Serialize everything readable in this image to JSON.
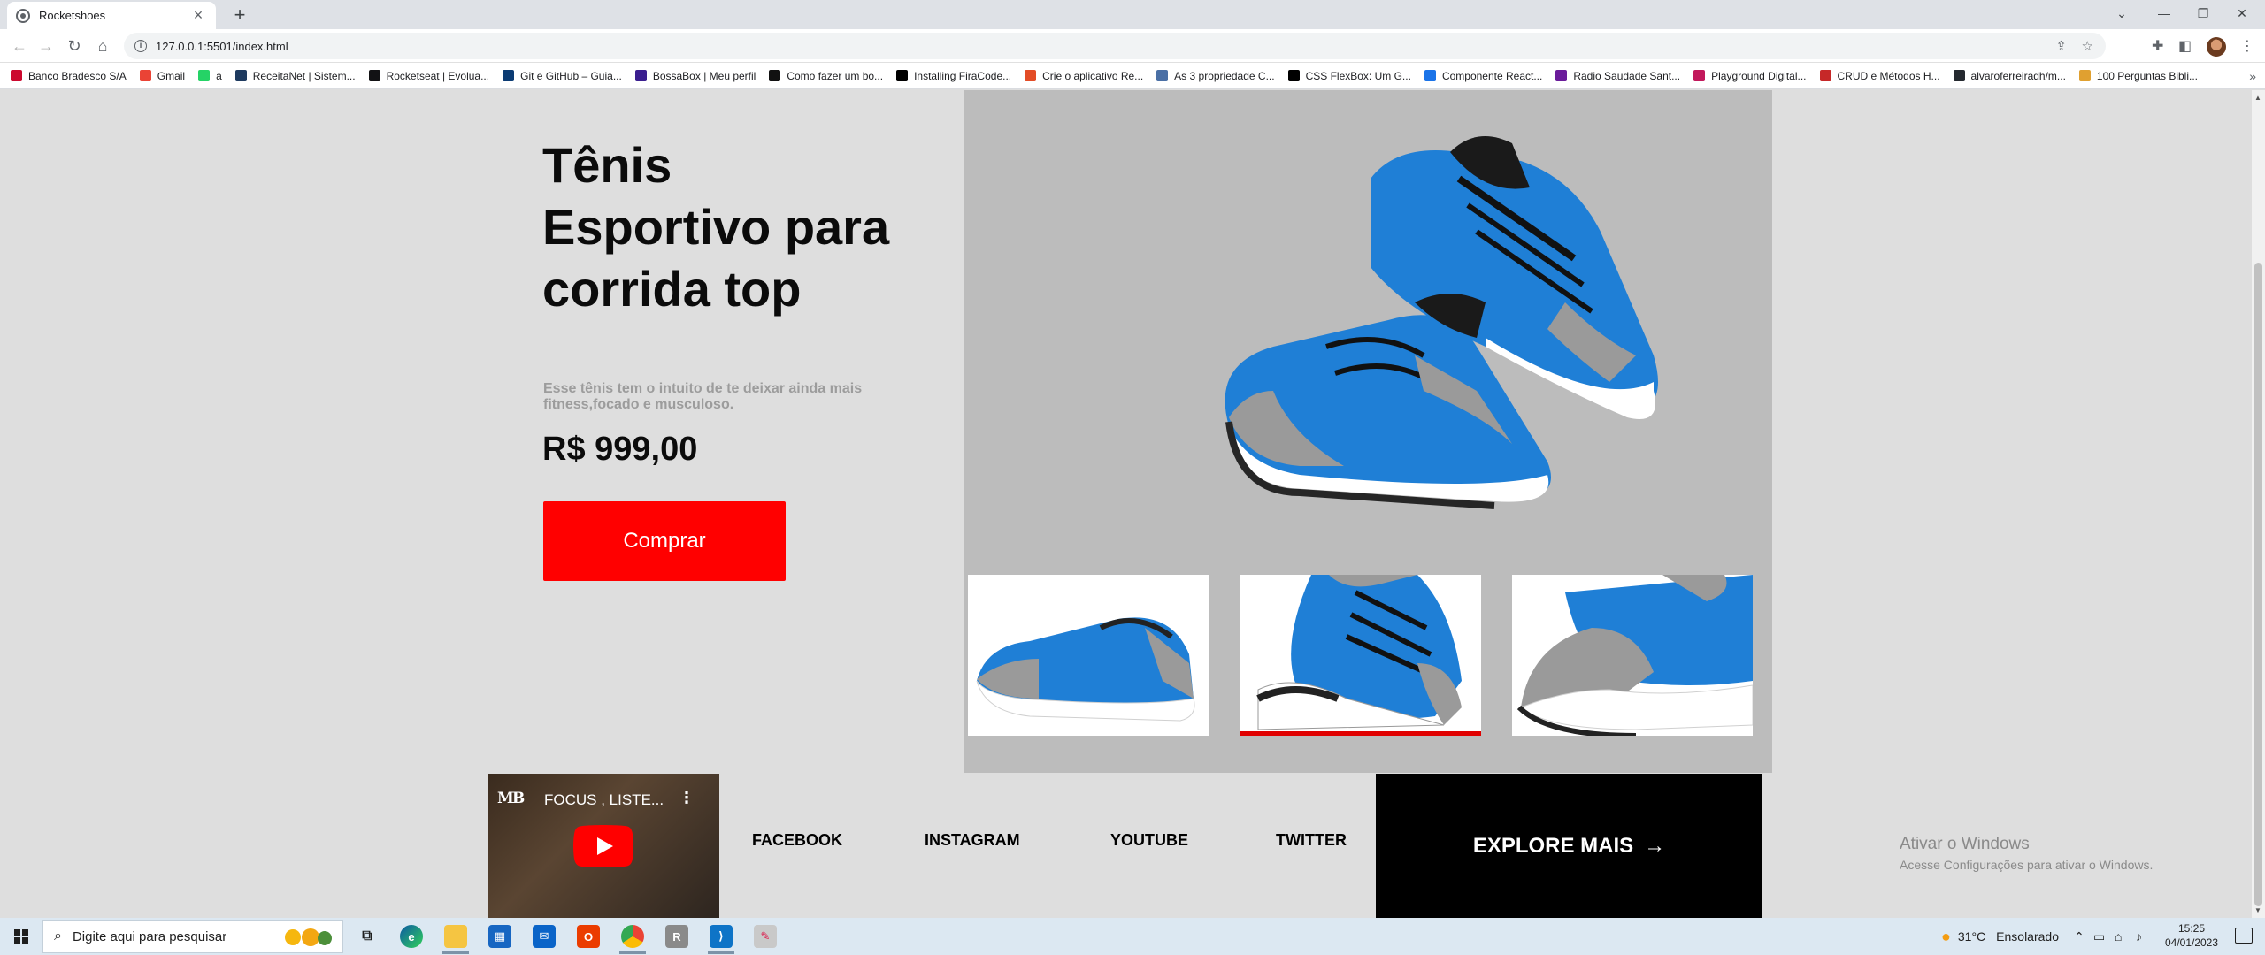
{
  "browser": {
    "tab_title": "Rocketshoes",
    "url": "127.0.0.1:5501/index.html",
    "bookmarks": [
      {
        "label": "Banco Bradesco S/A",
        "color": "#cc092f"
      },
      {
        "label": "Gmail",
        "color": "#ea4335"
      },
      {
        "label": "a",
        "color": "#25d366"
      },
      {
        "label": "ReceitaNet | Sistem...",
        "color": "#1e3a5f"
      },
      {
        "label": "Rocketseat | Evolua...",
        "color": "#121214"
      },
      {
        "label": "Git e GitHub – Guia...",
        "color": "#0b3b73"
      },
      {
        "label": "BossaBox | Meu perfil",
        "color": "#3a1e8f"
      },
      {
        "label": "Como fazer um bo...",
        "color": "#111111"
      },
      {
        "label": "Installing FiraCode...",
        "color": "#000000"
      },
      {
        "label": "Crie o aplicativo Re...",
        "color": "#e34c26"
      },
      {
        "label": "As 3 propriedade C...",
        "color": "#4a6fa5"
      },
      {
        "label": "CSS FlexBox: Um G...",
        "color": "#000000"
      },
      {
        "label": "Componente React...",
        "color": "#1a73e8"
      },
      {
        "label": "Radio Saudade Sant...",
        "color": "#6a1b9a"
      },
      {
        "label": "Playground Digital...",
        "color": "#c2185b"
      },
      {
        "label": "CRUD e Métodos H...",
        "color": "#c62828"
      },
      {
        "label": "alvaroferreiradh/m...",
        "color": "#24292f"
      },
      {
        "label": "100 Perguntas Bibli...",
        "color": "#e0a030"
      }
    ]
  },
  "product": {
    "title": "Tênis Esportivo para corrida top",
    "description": "Esse tênis tem o intuito de te deixar ainda mais fitness,focado e musculoso.",
    "price": "R$ 999,00",
    "buy_label": "Comprar",
    "colors": {
      "accent": "#ff0000",
      "shoe_blue": "#1f7fd6",
      "gallery_bg": "#bcbcbc"
    }
  },
  "footer": {
    "video": {
      "channel_logo": "MB",
      "title": "FOCUS , LISTE...",
      "menu_icon": "⋮"
    },
    "links": [
      "FACEBOOK",
      "INSTAGRAM",
      "YOUTUBE",
      "TWITTER"
    ],
    "explore_label": "EXPLORE MAIS",
    "explore_arrow": "→"
  },
  "windows_watermark": {
    "title": "Ativar o Windows",
    "subtitle": "Acesse Configurações para ativar o Windows."
  },
  "taskbar": {
    "search_placeholder": "Digite aqui para pesquisar",
    "temperature": "31°C",
    "weather": "Ensolarado",
    "time": "15:25",
    "date": "04/01/2023"
  }
}
